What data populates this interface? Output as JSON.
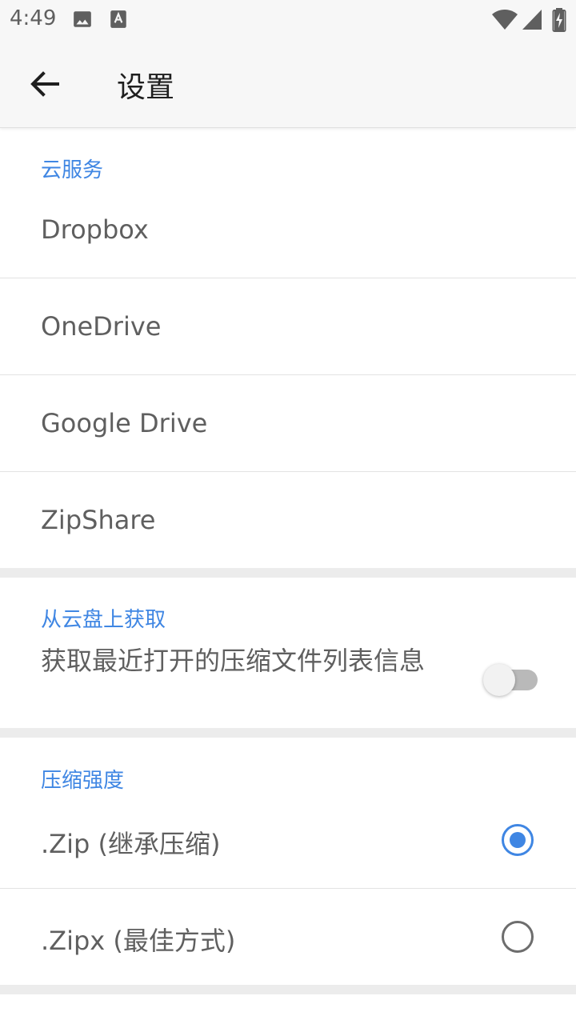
{
  "status_bar": {
    "time": "4:49",
    "left_icons": [
      "image-icon",
      "text-a-icon"
    ],
    "right_icons": [
      "wifi-icon",
      "signal-icon",
      "battery-charging-icon"
    ]
  },
  "toolbar": {
    "back_icon": "arrow-back-icon",
    "title": "设置"
  },
  "cloud_services": {
    "header": "云服务",
    "items": [
      {
        "label": "Dropbox"
      },
      {
        "label": "OneDrive"
      },
      {
        "label": "Google Drive"
      },
      {
        "label": "ZipShare"
      }
    ]
  },
  "cloud_fetch": {
    "header": "从云盘上获取",
    "label": "获取最近打开的压缩文件列表信息",
    "toggle_on": false
  },
  "compression": {
    "header": "压缩强度",
    "options": [
      {
        "label": ".Zip (继承压缩)",
        "selected": true
      },
      {
        "label": ".Zipx (最佳方式)",
        "selected": false
      }
    ]
  },
  "colors": {
    "accent": "#3f86e3",
    "header_bg": "#f7f7f7",
    "band": "#ececec"
  }
}
